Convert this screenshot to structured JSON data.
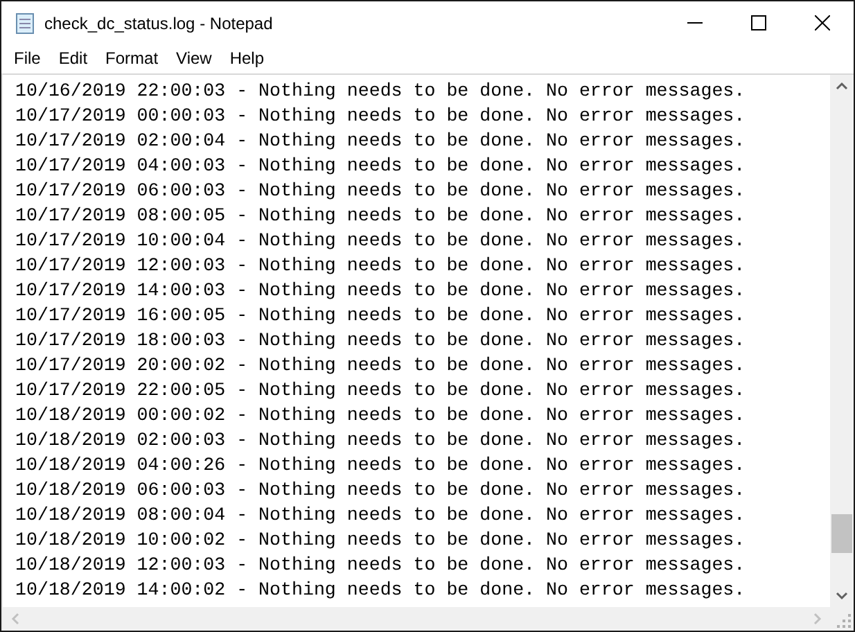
{
  "window": {
    "title": "check_dc_status.log - Notepad"
  },
  "menu": [
    "File",
    "Edit",
    "Format",
    "View",
    "Help"
  ],
  "lines": [
    "10/16/2019 22:00:03 - Nothing needs to be done. No error messages.",
    "10/17/2019 00:00:03 - Nothing needs to be done. No error messages.",
    "10/17/2019 02:00:04 - Nothing needs to be done. No error messages.",
    "10/17/2019 04:00:03 - Nothing needs to be done. No error messages.",
    "10/17/2019 06:00:03 - Nothing needs to be done. No error messages.",
    "10/17/2019 08:00:05 - Nothing needs to be done. No error messages.",
    "10/17/2019 10:00:04 - Nothing needs to be done. No error messages.",
    "10/17/2019 12:00:03 - Nothing needs to be done. No error messages.",
    "10/17/2019 14:00:03 - Nothing needs to be done. No error messages.",
    "10/17/2019 16:00:05 - Nothing needs to be done. No error messages.",
    "10/17/2019 18:00:03 - Nothing needs to be done. No error messages.",
    "10/17/2019 20:00:02 - Nothing needs to be done. No error messages.",
    "10/17/2019 22:00:05 - Nothing needs to be done. No error messages.",
    "10/18/2019 00:00:02 - Nothing needs to be done. No error messages.",
    "10/18/2019 02:00:03 - Nothing needs to be done. No error messages.",
    "10/18/2019 04:00:26 - Nothing needs to be done. No error messages.",
    "10/18/2019 06:00:03 - Nothing needs to be done. No error messages.",
    "10/18/2019 08:00:04 - Nothing needs to be done. No error messages.",
    "10/18/2019 10:00:02 - Nothing needs to be done. No error messages.",
    "10/18/2019 12:00:03 - Nothing needs to be done. No error messages.",
    "10/18/2019 14:00:02 - Nothing needs to be done. No error messages."
  ]
}
